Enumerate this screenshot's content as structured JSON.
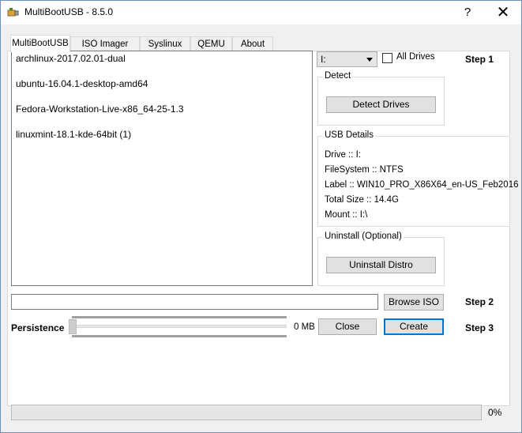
{
  "window": {
    "title": "MultiBootUSB - 8.5.0",
    "help_label": "?",
    "close_label": "✕"
  },
  "tabs": [
    {
      "label": "MultiBootUSB",
      "active": true
    },
    {
      "label": "ISO Imager",
      "active": false
    },
    {
      "label": "Syslinux",
      "active": false
    },
    {
      "label": "QEMU",
      "active": false
    },
    {
      "label": "About",
      "active": false
    }
  ],
  "distro_list": [
    "archlinux-2017.02.01-dual",
    "ubuntu-16.04.1-desktop-amd64",
    "Fedora-Workstation-Live-x86_64-25-1.3",
    "linuxmint-18.1-kde-64bit (1)"
  ],
  "drive_select": {
    "value": "I:"
  },
  "all_drives": {
    "label": "All Drives",
    "checked": false
  },
  "steps": {
    "step1": "Step 1",
    "step2": "Step 2",
    "step3": "Step 3"
  },
  "detect": {
    "title": "Detect",
    "button": "Detect Drives"
  },
  "usb_details": {
    "title": "USB Details",
    "drive": "Drive :: I:",
    "filesystem": "FileSystem :: NTFS",
    "label": "Label :: WIN10_PRO_X86X64_en-US_Feb2016",
    "total_size": "Total Size :: 14.4G",
    "mount": "Mount :: I:\\"
  },
  "uninstall": {
    "title": "Uninstall (Optional)",
    "button": "Uninstall Distro"
  },
  "iso_path": {
    "value": ""
  },
  "browse_button": "Browse ISO",
  "persistence": {
    "label": "Persistence",
    "value": "0 MB",
    "level": 0
  },
  "close_button": "Close",
  "create_button": "Create",
  "progress": {
    "value": 0,
    "text": "0%"
  }
}
